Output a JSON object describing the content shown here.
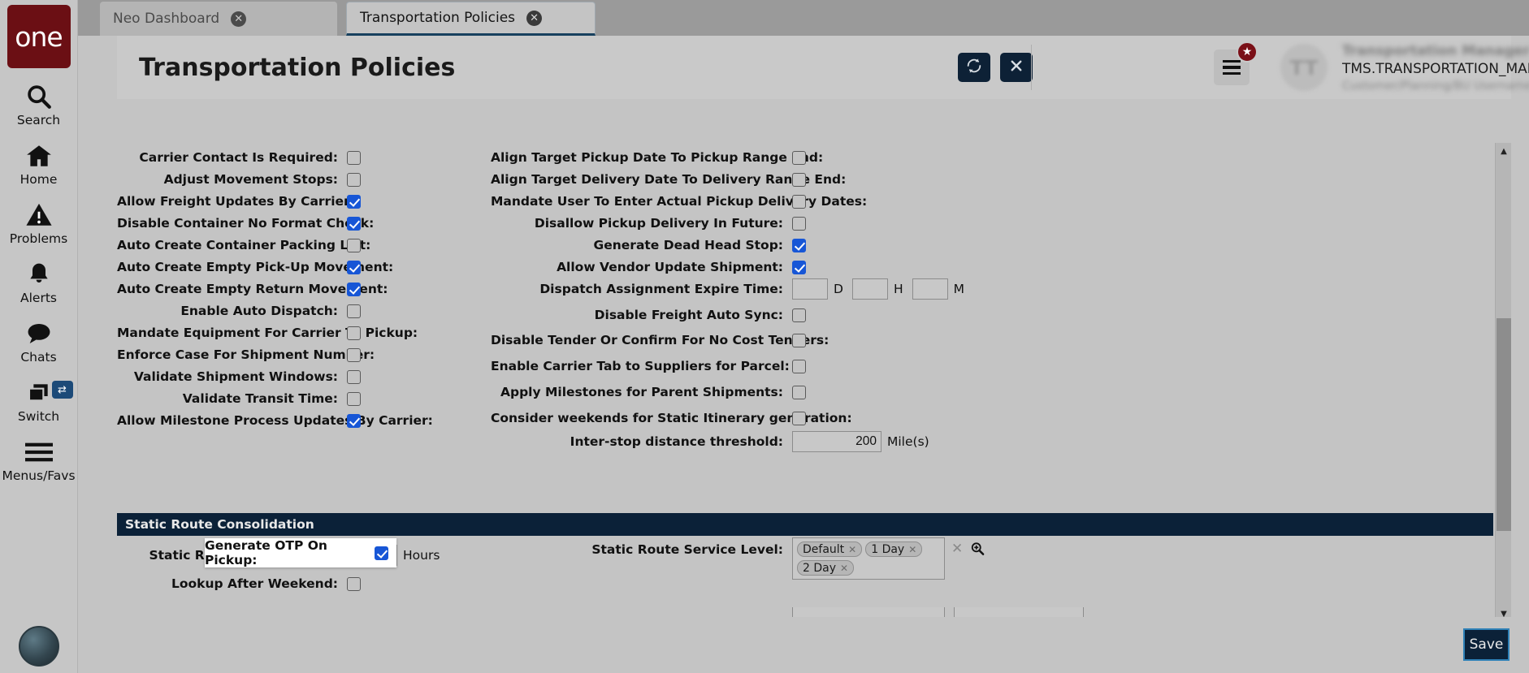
{
  "brand": {
    "logo_text": "one"
  },
  "sidebar": {
    "items": [
      {
        "label": "Search",
        "icon": "search-icon"
      },
      {
        "label": "Home",
        "icon": "home-icon"
      },
      {
        "label": "Problems",
        "icon": "warning-triangle-icon"
      },
      {
        "label": "Alerts",
        "icon": "bell-icon"
      },
      {
        "label": "Chats",
        "icon": "chat-bubble-icon"
      },
      {
        "label": "Switch",
        "icon": "windows-switch-icon",
        "badge": "⇄"
      },
      {
        "label": "Menus/Favs",
        "icon": "hamburger-icon"
      }
    ]
  },
  "tabs": [
    {
      "label": "Neo Dashboard",
      "active": false,
      "close": "✖"
    },
    {
      "label": "Transportation Policies",
      "active": true,
      "close": "✖"
    }
  ],
  "header": {
    "title": "Transportation Policies",
    "refresh_icon": "refresh-icon",
    "close_icon": "close-icon",
    "menu_icon": "hamburger-menu-icon",
    "star_badge": "★",
    "avatar_initials": "TT",
    "user_name": "Transportation Manager Test",
    "user_login": "TMS.TRANSPORTATION_MANAGER",
    "user_role": "Customer/Planning/BU Username",
    "caret": "⌄"
  },
  "left_column": [
    {
      "label": "Carrier Contact Is Required:",
      "checked": false
    },
    {
      "label": "Adjust Movement Stops:",
      "checked": false
    },
    {
      "label": "Allow Freight Updates By Carrier:",
      "checked": true
    },
    {
      "label": "Disable Container No Format Check:",
      "checked": true
    },
    {
      "label": "Auto Create Container Packing List:",
      "checked": false
    },
    {
      "label": "Auto Create Empty Pick-Up Movement:",
      "checked": true
    },
    {
      "label": "Auto Create Empty Return Movement:",
      "checked": true
    },
    {
      "label": "Enable Auto Dispatch:",
      "checked": false
    },
    {
      "label": "Mandate Equipment For Carrier To Pickup:",
      "checked": false
    },
    {
      "label": "Enforce Case For Shipment Number:",
      "checked": false
    },
    {
      "label": "Validate Shipment Windows:",
      "checked": false
    },
    {
      "label": "Validate Transit Time:",
      "checked": false
    },
    {
      "label": "Allow Milestone Process Updates By Carrier:",
      "checked": true
    }
  ],
  "otp_popup": {
    "label": "Generate OTP On Pickup:",
    "checked": true
  },
  "right_column": [
    {
      "label": "Align Target Pickup Date To Pickup Range End:",
      "type": "checkbox",
      "checked": false
    },
    {
      "label": "Align Target Delivery Date To Delivery Range End:",
      "type": "checkbox",
      "checked": false
    },
    {
      "label": "Mandate User To Enter Actual Pickup Delivery Dates:",
      "type": "checkbox",
      "checked": false
    },
    {
      "label": "Disallow Pickup Delivery In Future:",
      "type": "checkbox",
      "checked": false
    },
    {
      "label": "Generate Dead Head Stop:",
      "type": "checkbox",
      "checked": true
    },
    {
      "label": "Allow Vendor Update Shipment:",
      "type": "checkbox",
      "checked": true
    },
    {
      "label": "Dispatch Assignment Expire Time:",
      "type": "dhm",
      "days": "",
      "days_unit": "D",
      "hours": "",
      "hours_unit": "H",
      "minutes": "",
      "minutes_unit": "M"
    },
    {
      "label": "Disable Freight Auto Sync:",
      "type": "checkbox",
      "checked": false
    },
    {
      "label": "Disable Tender Or Confirm For No Cost Tenders:",
      "type": "checkbox",
      "checked": false
    },
    {
      "label": "Enable Carrier Tab to Suppliers for Parcel:",
      "type": "checkbox",
      "checked": false
    },
    {
      "label": "Apply Milestones for Parent Shipments:",
      "type": "checkbox",
      "checked": false
    },
    {
      "label": "Consider weekends for Static Itinerary generation:",
      "type": "checkbox",
      "checked": false
    },
    {
      "label": "Inter-stop distance threshold:",
      "type": "text",
      "value": "200",
      "unit": "Mile(s)"
    }
  ],
  "section": {
    "title": "Static Route Consolidation"
  },
  "consolidation": {
    "lookup_limit": {
      "label": "Static Route Lookup Limit:",
      "value": "",
      "unit": "Hours"
    },
    "lookup_after_weekend": {
      "label": "Lookup After Weekend:",
      "checked": false
    },
    "service_level": {
      "label": "Static Route Service Level:",
      "chips": [
        "Default",
        "1 Day",
        "2 Day"
      ],
      "chip_remove": "✖",
      "clear": "✕",
      "search_icon": "search-magnifier-icon"
    }
  },
  "footer": {
    "save_label": "Save"
  },
  "scrollbar": {
    "up": "▲",
    "down": "▼"
  }
}
